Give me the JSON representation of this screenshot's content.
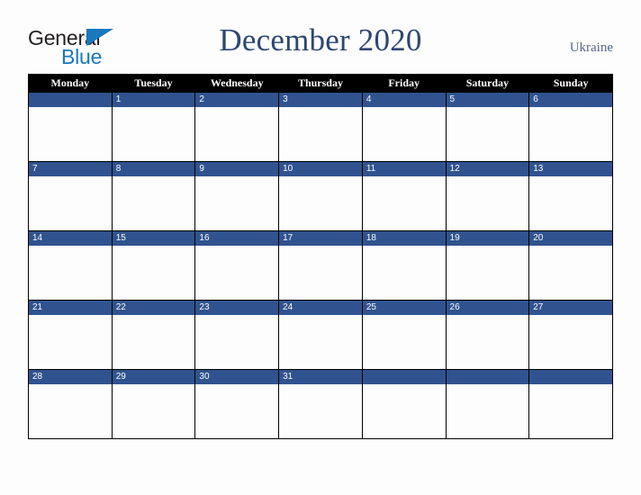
{
  "logo": {
    "word1": "General",
    "word2": "Blue",
    "triangle_color": "#1878be",
    "word1_color": "#231f20",
    "word2_color": "#1878be"
  },
  "header": {
    "title": "December 2020",
    "country": "Ukraine",
    "title_color": "#2d4671",
    "country_color": "#54678c"
  },
  "calendar": {
    "weekday_headers": [
      "Monday",
      "Tuesday",
      "Wednesday",
      "Thursday",
      "Friday",
      "Saturday",
      "Sunday"
    ],
    "header_bg": "#000000",
    "header_text_color": "#ffffff",
    "daynum_bg": "#30538f",
    "daynum_text_color": "#ffffff",
    "cell_bg": "#fdfdfd",
    "grid_line_color": "#000000",
    "weeks": [
      [
        "",
        "1",
        "2",
        "3",
        "4",
        "5",
        "6"
      ],
      [
        "7",
        "8",
        "9",
        "10",
        "11",
        "12",
        "13"
      ],
      [
        "14",
        "15",
        "16",
        "17",
        "18",
        "19",
        "20"
      ],
      [
        "21",
        "22",
        "23",
        "24",
        "25",
        "26",
        "27"
      ],
      [
        "28",
        "29",
        "30",
        "31",
        "",
        "",
        ""
      ]
    ]
  }
}
